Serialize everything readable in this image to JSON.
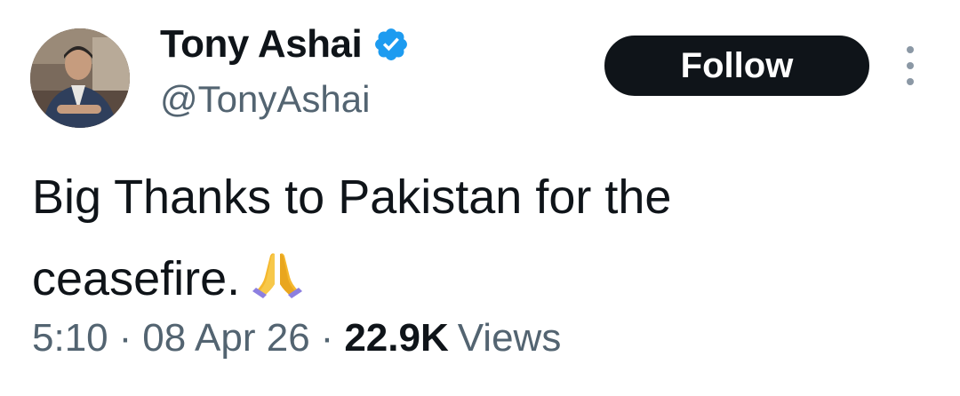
{
  "author": {
    "display_name": "Tony Ashai",
    "handle": "@TonyAshai",
    "verified": true,
    "verified_color": "#1d9bf0"
  },
  "actions": {
    "follow_label": "Follow"
  },
  "tweet": {
    "text_line1": "Big Thanks to Pakistan for the",
    "text_line2": "ceasefire.",
    "emoji": "folded-hands-icon"
  },
  "meta": {
    "time": "5:10",
    "separator": "·",
    "date": "08 Apr 26",
    "views_count": "22.9K",
    "views_label": "Views"
  },
  "colors": {
    "text_primary": "#0f1419",
    "text_secondary": "#536471",
    "button_bg": "#0f1419",
    "button_text": "#ffffff"
  }
}
